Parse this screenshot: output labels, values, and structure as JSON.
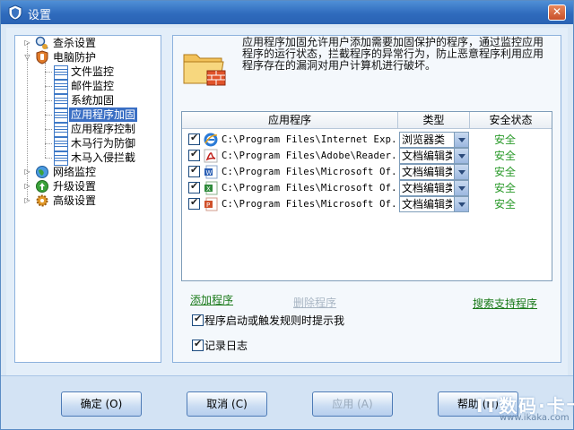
{
  "window": {
    "title": "设置",
    "close_label": "✕"
  },
  "tree": {
    "items": [
      {
        "label": "查杀设置",
        "level": 0,
        "icon": "search-bug-icon"
      },
      {
        "label": "电脑防护",
        "level": 0,
        "icon": "shield-hand-icon"
      },
      {
        "label": "文件监控",
        "level": 1,
        "icon": "page-icon"
      },
      {
        "label": "邮件监控",
        "level": 1,
        "icon": "page-icon"
      },
      {
        "label": "系统加固",
        "level": 1,
        "icon": "page-icon"
      },
      {
        "label": "应用程序加固",
        "level": 1,
        "icon": "page-icon",
        "selected": true
      },
      {
        "label": "应用程序控制",
        "level": 1,
        "icon": "page-icon"
      },
      {
        "label": "木马行为防御",
        "level": 1,
        "icon": "page-icon"
      },
      {
        "label": "木马入侵拦截",
        "level": 1,
        "icon": "page-icon"
      },
      {
        "label": "网络监控",
        "level": 0,
        "icon": "globe-icon"
      },
      {
        "label": "升级设置",
        "level": 0,
        "icon": "update-icon"
      },
      {
        "label": "高级设置",
        "level": 0,
        "icon": "gear-icon"
      }
    ]
  },
  "description": "应用程序加固允许用户添加需要加固保护的程序，通过监控应用程序的运行状态，拦截程序的异常行为，防止恶意程序利用应用程序存在的漏洞对用户计算机进行破坏。",
  "table": {
    "headers": {
      "app": "应用程序",
      "type": "类型",
      "status": "安全状态"
    },
    "rows": [
      {
        "checked": true,
        "icon": "ie-icon",
        "path": "C:\\Program Files\\Internet Exp...",
        "type": "浏览器类",
        "status": "安全"
      },
      {
        "checked": true,
        "icon": "pdf-icon",
        "path": "C:\\Program Files\\Adobe\\Reader...",
        "type": "文档编辑类",
        "status": "安全"
      },
      {
        "checked": true,
        "icon": "word-icon",
        "path": "C:\\Program Files\\Microsoft Of...",
        "type": "文档编辑类",
        "status": "安全"
      },
      {
        "checked": true,
        "icon": "excel-icon",
        "path": "C:\\Program Files\\Microsoft Of...",
        "type": "文档编辑类",
        "status": "安全"
      },
      {
        "checked": true,
        "icon": "powerpoint-icon",
        "path": "C:\\Program Files\\Microsoft Of...",
        "type": "文档编辑类",
        "status": "安全"
      }
    ]
  },
  "actions": {
    "add": "添加程序",
    "delete": "删除程序",
    "search": "搜索支持程序"
  },
  "options": {
    "prompt": "程序启动或触发规则时提示我",
    "log": "记录日志"
  },
  "buttons": {
    "ok": "确定 (O)",
    "cancel": "取消 (C)",
    "apply": "应用 (A)",
    "help": "帮助 (H)"
  },
  "watermark": {
    "big": "IT数码·卡卡",
    "small": "www.ikaka.com"
  },
  "colors": {
    "status_safe": "#2a9a2a",
    "link_green": "#1a7a1a",
    "selection": "#3a6fc4"
  }
}
